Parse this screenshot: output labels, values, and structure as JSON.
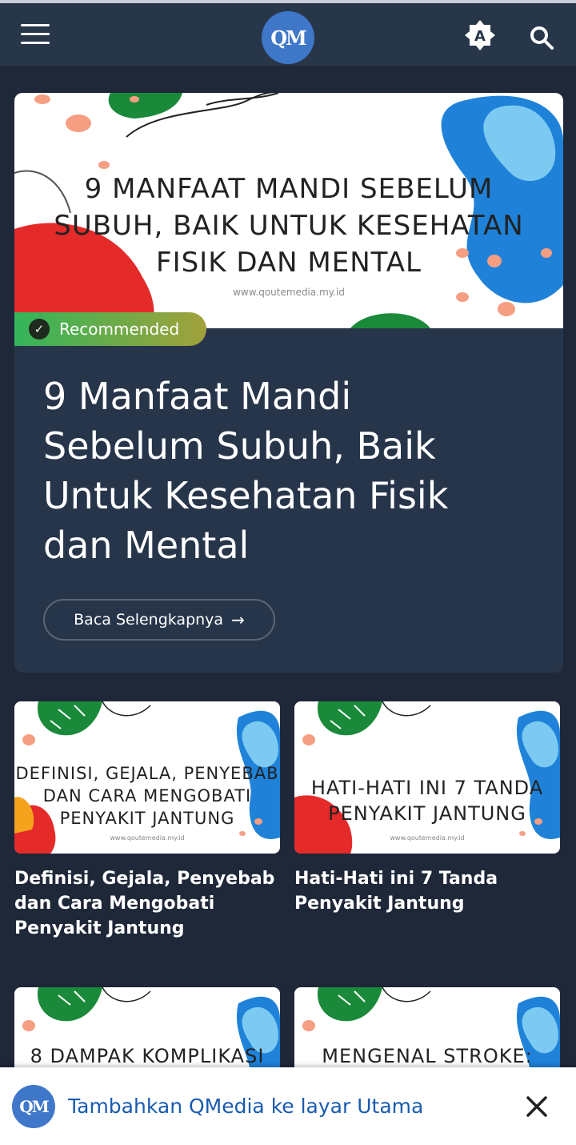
{
  "header": {
    "logo_text": "QM",
    "icons": {
      "menu": "hamburger-icon",
      "theme": "brightness-auto-icon",
      "search": "search-icon"
    }
  },
  "hero": {
    "image_lines": [
      "9 MANFAAT MANDI SEBELUM",
      "SUBUH, BAIK UNTUK KESEHATAN",
      "FISIK DAN MENTAL"
    ],
    "image_url": "www.qoutemedia.my.id",
    "badge": "Recommended",
    "title": "9 Manfaat Mandi Sebelum Subuh, Baik Untuk Kesehatan Fisik dan Mental",
    "read_more": "Baca Selengkapnya"
  },
  "posts": [
    {
      "image_lines": [
        "DEFINISI, GEJALA, PENYEBAB",
        "DAN CARA MENGOBATI",
        "PENYAKIT JANTUNG"
      ],
      "image_url": "www.qoutemedia.my.id",
      "title": "Definisi, Gejala, Penyebab dan Cara Mengobati Penyakit Jantung"
    },
    {
      "image_lines": [
        "HATI-HATI INI 7 TANDA",
        "PENYAKIT JANTUNG"
      ],
      "image_url": "www.qoutemedia.my.id",
      "title": "Hati-Hati ini 7 Tanda Penyakit Jantung"
    },
    {
      "image_lines": [
        "8 DAMPAK KOMPLIKASI"
      ]
    },
    {
      "image_lines": [
        "MENGENAL STROKE:"
      ]
    }
  ],
  "install_banner": {
    "logo_text": "QM",
    "text": "Tambahkan QMedia ke layar Utama"
  },
  "colors": {
    "background": "#1e2838",
    "header": "#28364a",
    "card": "#27354a",
    "accent_blue": "#3f77c9",
    "badge_green": "#33b55a",
    "banner_link": "#1a5bb0"
  }
}
